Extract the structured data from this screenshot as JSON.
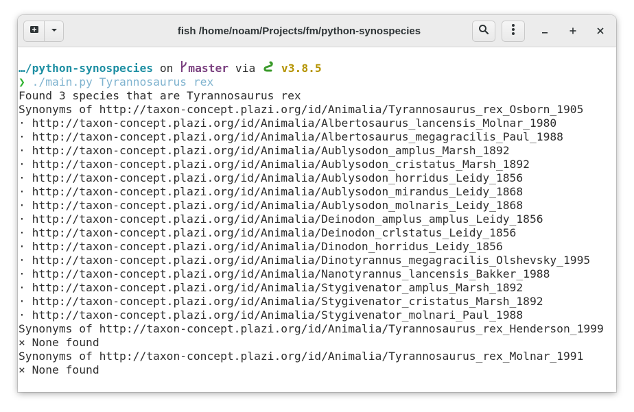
{
  "window": {
    "title": "fish /home/noam/Projects/fm/python-synospecies"
  },
  "icons": {
    "new_tab": "new-tab-icon",
    "dropdown": "chevron-down-icon",
    "search": "search-icon",
    "menu": "kebab-menu-icon",
    "minimize": "minimize-icon",
    "maximize": "maximize-icon",
    "close": "close-icon"
  },
  "colors": {
    "path": "#1e8fa3",
    "branch": "#7a3f7f",
    "version": "#b49300",
    "prompt": "#2fb32f",
    "command": "#7fb3cf"
  },
  "prompt": {
    "path": "…/python-synospecies",
    "on": " on ",
    "branch_glyph": "",
    "branch": "master",
    "via": " via ",
    "python_glyph": "🐍",
    "version": "v3.8.5",
    "prompt_char": "❯",
    "command": "./main.py Tyrannosaurus rex"
  },
  "output": {
    "summary": "Found 3 species that are Tyrannosaurus rex",
    "groups": [
      {
        "header": "Synonyms of http://taxon-concept.plazi.org/id/Animalia/Tyrannosaurus_rex_Osborn_1905",
        "items": [
          "· http://taxon-concept.plazi.org/id/Animalia/Albertosaurus_lancensis_Molnar_1980",
          "· http://taxon-concept.plazi.org/id/Animalia/Albertosaurus_megagracilis_Paul_1988",
          "· http://taxon-concept.plazi.org/id/Animalia/Aublysodon_amplus_Marsh_1892",
          "· http://taxon-concept.plazi.org/id/Animalia/Aublysodon_cristatus_Marsh_1892",
          "· http://taxon-concept.plazi.org/id/Animalia/Aublysodon_horridus_Leidy_1856",
          "· http://taxon-concept.plazi.org/id/Animalia/Aublysodon_mirandus_Leidy_1868",
          "· http://taxon-concept.plazi.org/id/Animalia/Aublysodon_molnaris_Leidy_1868",
          "· http://taxon-concept.plazi.org/id/Animalia/Deinodon_amplus_amplus_Leidy_1856",
          "· http://taxon-concept.plazi.org/id/Animalia/Deinodon_crlstatus_Leidy_1856",
          "· http://taxon-concept.plazi.org/id/Animalia/Dinodon_horridus_Leidy_1856",
          "· http://taxon-concept.plazi.org/id/Animalia/Dinotyrannus_megagracilis_Olshevsky_1995",
          "· http://taxon-concept.plazi.org/id/Animalia/Nanotyrannus_lancensis_Bakker_1988",
          "· http://taxon-concept.plazi.org/id/Animalia/Stygivenator_amplus_Marsh_1892",
          "· http://taxon-concept.plazi.org/id/Animalia/Stygivenator_cristatus_Marsh_1892",
          "· http://taxon-concept.plazi.org/id/Animalia/Stygivenator_molnari_Paul_1988"
        ]
      },
      {
        "header": "Synonyms of http://taxon-concept.plazi.org/id/Animalia/Tyrannosaurus_rex_Henderson_1999",
        "items": [
          "× None found"
        ]
      },
      {
        "header": "Synonyms of http://taxon-concept.plazi.org/id/Animalia/Tyrannosaurus_rex_Molnar_1991",
        "items": [
          "× None found"
        ]
      }
    ]
  }
}
